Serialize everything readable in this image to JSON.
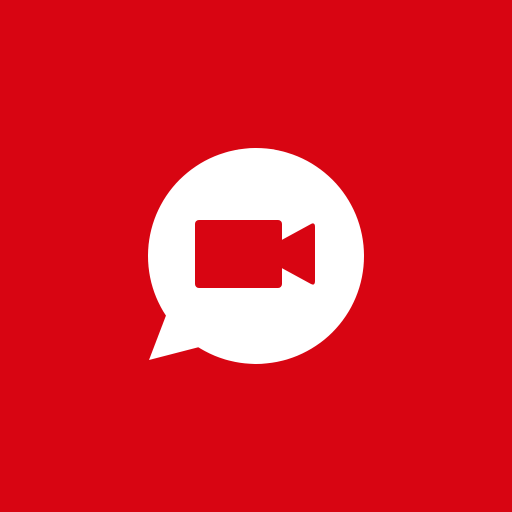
{
  "app_icon": {
    "icon_name": "video-chat-icon",
    "background_color": "#d80512",
    "bubble_color": "#ffffff",
    "camera_color": "#d80512"
  }
}
